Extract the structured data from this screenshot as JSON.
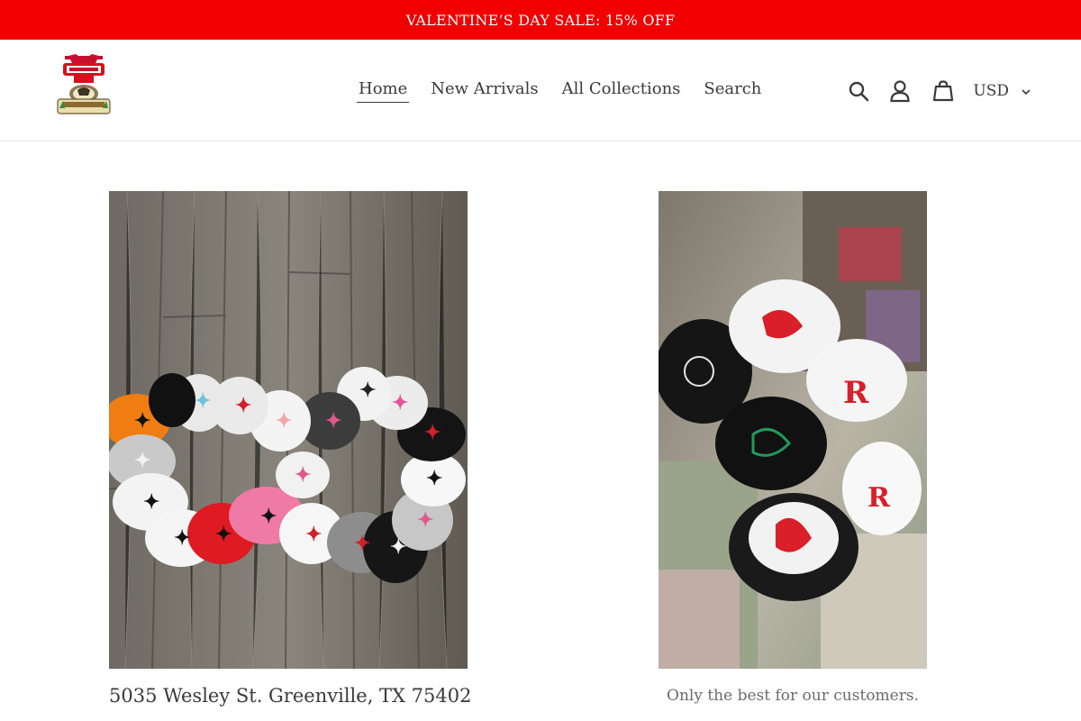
{
  "announcement": {
    "text": "VALENTINE’S DAY SALE: 15% OFF"
  },
  "header": {
    "logo_alt": "Western Wear store logo",
    "nav": [
      {
        "label": "Home",
        "active": true
      },
      {
        "label": "New Arrivals",
        "active": false
      },
      {
        "label": "All Collections",
        "active": false
      },
      {
        "label": "Search",
        "active": false
      }
    ],
    "icons": [
      "search-icon",
      "account-icon",
      "cart-icon"
    ],
    "currency": "USD"
  },
  "features": [
    {
      "image": "Circle of embroidered snapback hats on wood floor",
      "caption": "5035 Wesley St. Greenville, TX 75402"
    },
    {
      "image": "Trucker hats displayed on a store counter",
      "caption": "Only the best for our customers."
    }
  ],
  "colors": {
    "announcement_bg": "#f00000",
    "text": "#3a3a3a",
    "muted": "#6b6b6b"
  }
}
